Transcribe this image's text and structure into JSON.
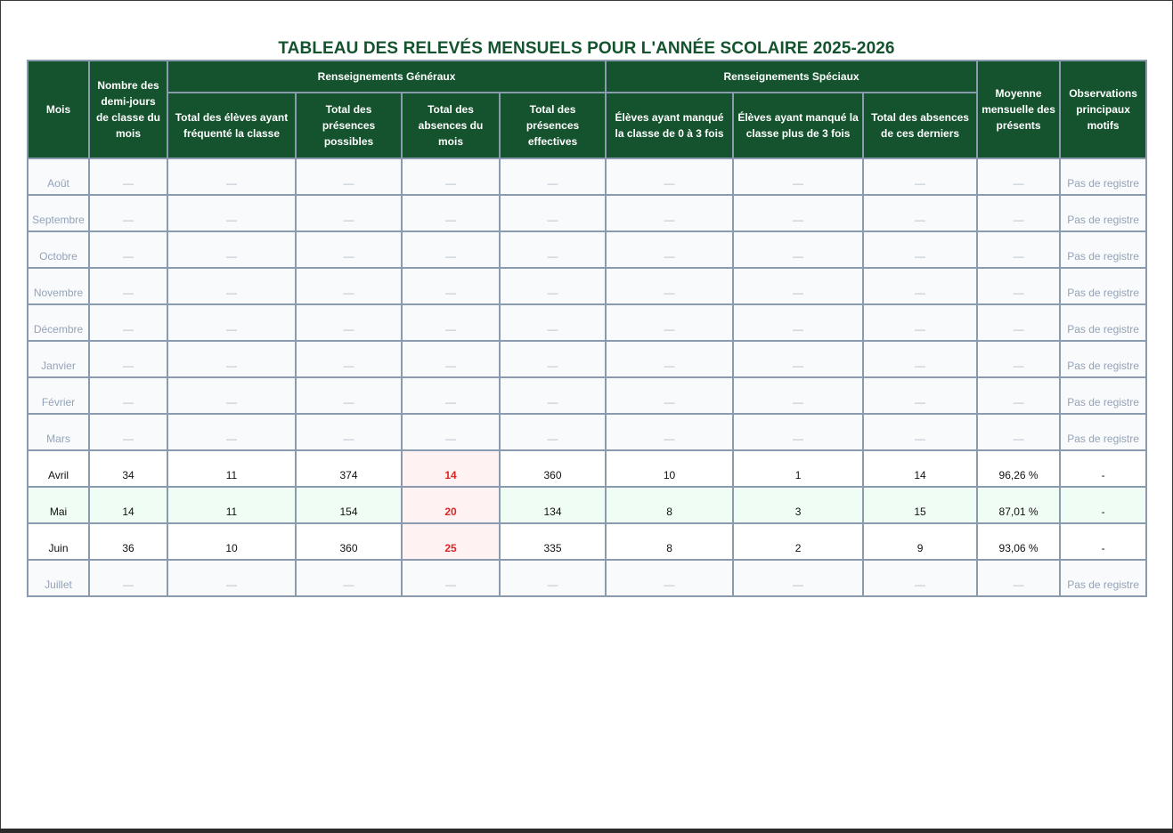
{
  "title": "TABLEAU DES RELEVÉS MENSUELS POUR L'ANNÉE SCOLAIRE 2025-2026",
  "headers": {
    "mois": "Mois",
    "demi_jours": "Nombre des demi-jours de classe du mois",
    "group_generaux": "Renseignements Généraux",
    "group_speciaux": "Renseignements Spéciaux",
    "moyenne": "Moyenne mensuelle des présents",
    "observations": "Observations principaux motifs",
    "total_eleves": "Total des élèves ayant fréquenté la classe",
    "presences_possibles": "Total des présences possibles",
    "absences_mois": "Total des absences du mois",
    "presences_effectives": "Total des présences effectives",
    "manque_0_3": "Élèves ayant manqué la classe de 0 à 3 fois",
    "manque_plus_3": "Élèves ayant manqué la classe plus de 3 fois",
    "absences_derniers": "Total des absences de ces derniers"
  },
  "rows": [
    {
      "mois": "Août",
      "demi_jours": "—",
      "total_eleves": "—",
      "presences_possibles": "—",
      "absences_mois": "—",
      "presences_effectives": "—",
      "manque_0_3": "—",
      "manque_plus_3": "—",
      "absences_derniers": "—",
      "moyenne": "—",
      "observations": "Pas de registre"
    },
    {
      "mois": "Septembre",
      "demi_jours": "—",
      "total_eleves": "—",
      "presences_possibles": "—",
      "absences_mois": "—",
      "presences_effectives": "—",
      "manque_0_3": "—",
      "manque_plus_3": "—",
      "absences_derniers": "—",
      "moyenne": "—",
      "observations": "Pas de registre"
    },
    {
      "mois": "Octobre",
      "demi_jours": "—",
      "total_eleves": "—",
      "presences_possibles": "—",
      "absences_mois": "—",
      "presences_effectives": "—",
      "manque_0_3": "—",
      "manque_plus_3": "—",
      "absences_derniers": "—",
      "moyenne": "—",
      "observations": "Pas de registre"
    },
    {
      "mois": "Novembre",
      "demi_jours": "—",
      "total_eleves": "—",
      "presences_possibles": "—",
      "absences_mois": "—",
      "presences_effectives": "—",
      "manque_0_3": "—",
      "manque_plus_3": "—",
      "absences_derniers": "—",
      "moyenne": "—",
      "observations": "Pas de registre"
    },
    {
      "mois": "Décembre",
      "demi_jours": "—",
      "total_eleves": "—",
      "presences_possibles": "—",
      "absences_mois": "—",
      "presences_effectives": "—",
      "manque_0_3": "—",
      "manque_plus_3": "—",
      "absences_derniers": "—",
      "moyenne": "—",
      "observations": "Pas de registre"
    },
    {
      "mois": "Janvier",
      "demi_jours": "—",
      "total_eleves": "—",
      "presences_possibles": "—",
      "absences_mois": "—",
      "presences_effectives": "—",
      "manque_0_3": "—",
      "manque_plus_3": "—",
      "absences_derniers": "—",
      "moyenne": "—",
      "observations": "Pas de registre"
    },
    {
      "mois": "Février",
      "demi_jours": "—",
      "total_eleves": "—",
      "presences_possibles": "—",
      "absences_mois": "—",
      "presences_effectives": "—",
      "manque_0_3": "—",
      "manque_plus_3": "—",
      "absences_derniers": "—",
      "moyenne": "—",
      "observations": "Pas de registre"
    },
    {
      "mois": "Mars",
      "demi_jours": "—",
      "total_eleves": "—",
      "presences_possibles": "—",
      "absences_mois": "—",
      "presences_effectives": "—",
      "manque_0_3": "—",
      "manque_plus_3": "—",
      "absences_derniers": "—",
      "moyenne": "—",
      "observations": "Pas de registre"
    },
    {
      "mois": "Avril",
      "demi_jours": "34",
      "total_eleves": "11",
      "presences_possibles": "374",
      "absences_mois": "14",
      "presences_effectives": "360",
      "manque_0_3": "10",
      "manque_plus_3": "1",
      "absences_derniers": "14",
      "moyenne": "96,26 %",
      "observations": "-"
    },
    {
      "mois": "Mai",
      "demi_jours": "14",
      "total_eleves": "11",
      "presences_possibles": "154",
      "absences_mois": "20",
      "presences_effectives": "134",
      "manque_0_3": "8",
      "manque_plus_3": "3",
      "absences_derniers": "15",
      "moyenne": "87,01 %",
      "observations": "-"
    },
    {
      "mois": "Juin",
      "demi_jours": "36",
      "total_eleves": "10",
      "presences_possibles": "360",
      "absences_mois": "25",
      "presences_effectives": "335",
      "manque_0_3": "8",
      "manque_plus_3": "2",
      "absences_derniers": "9",
      "moyenne": "93,06 %",
      "observations": "-"
    },
    {
      "mois": "Juillet",
      "demi_jours": "—",
      "total_eleves": "—",
      "presences_possibles": "—",
      "absences_mois": "—",
      "presences_effectives": "—",
      "manque_0_3": "—",
      "manque_plus_3": "—",
      "absences_derniers": "—",
      "moyenne": "—",
      "observations": "Pas de registre"
    }
  ]
}
